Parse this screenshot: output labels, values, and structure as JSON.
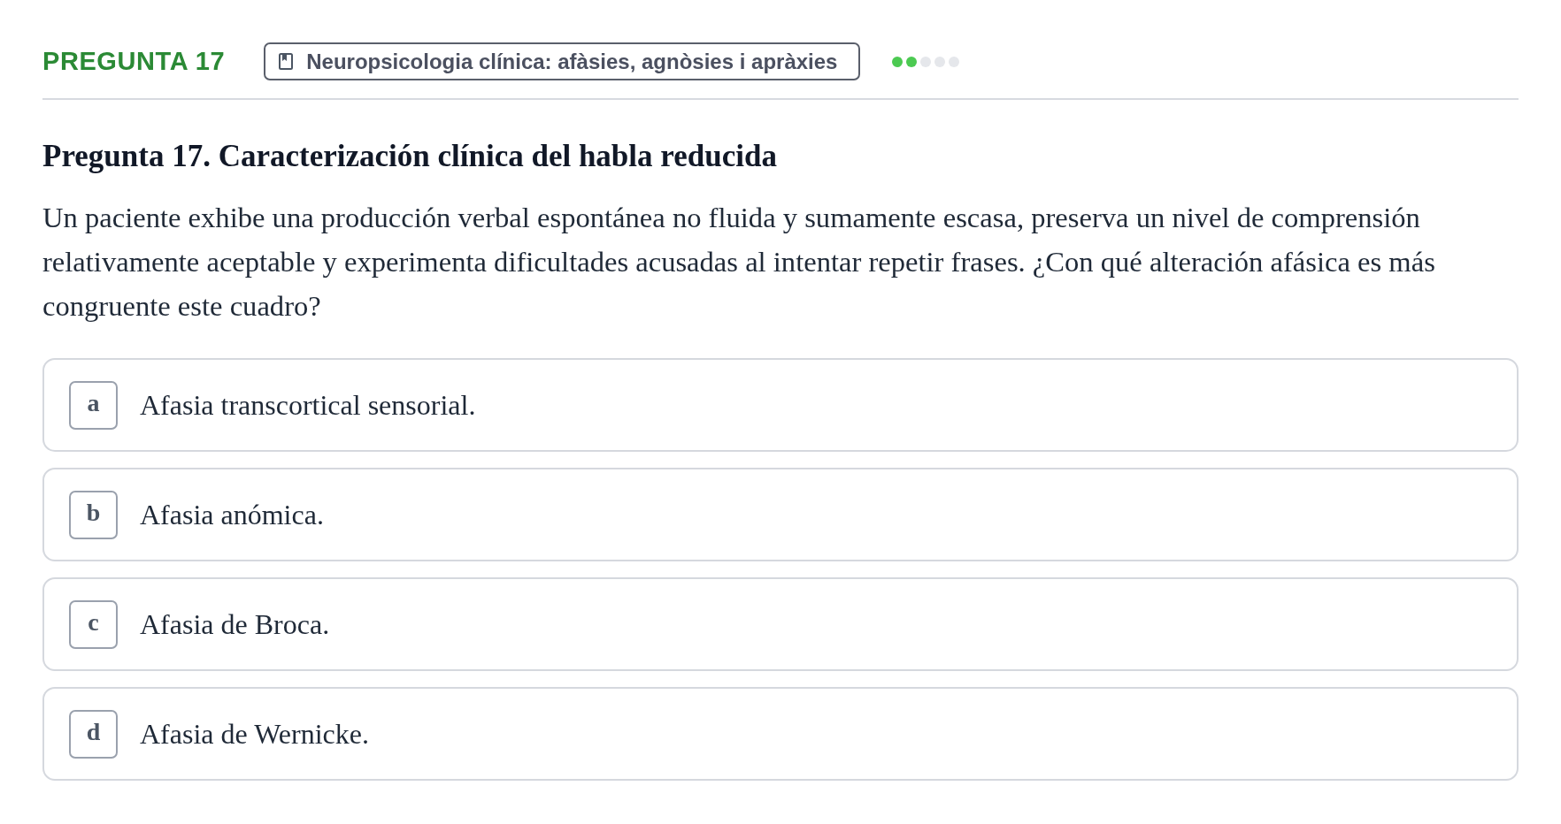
{
  "header": {
    "label": "PREGUNTA 17",
    "topic": {
      "text": "Neuropsicologia clínica: afàsies, agnòsies i apràxies"
    },
    "difficulty": [
      {
        "filled": true
      },
      {
        "filled": true
      },
      {
        "filled": false
      },
      {
        "filled": false
      },
      {
        "filled": false
      }
    ]
  },
  "question": {
    "title": "Pregunta 17. Caracterización clínica del habla reducida",
    "text": "Un paciente exhibe una producción verbal espontánea no fluida y sumamente escasa, preserva un nivel de comprensión relativamente aceptable y experimenta dificultades acusadas al intentar repetir frases. ¿Con qué alteración afásica es más congruente este cuadro?"
  },
  "options": [
    {
      "letter": "a",
      "text": "Afasia transcortical sensorial.",
      "selected": false
    },
    {
      "letter": "b",
      "text": "Afasia anómica.",
      "selected": false
    },
    {
      "letter": "c",
      "text": "Afasia de Broca.",
      "selected": false
    },
    {
      "letter": "d",
      "text": "Afasia de Wernicke.",
      "selected": false
    }
  ]
}
